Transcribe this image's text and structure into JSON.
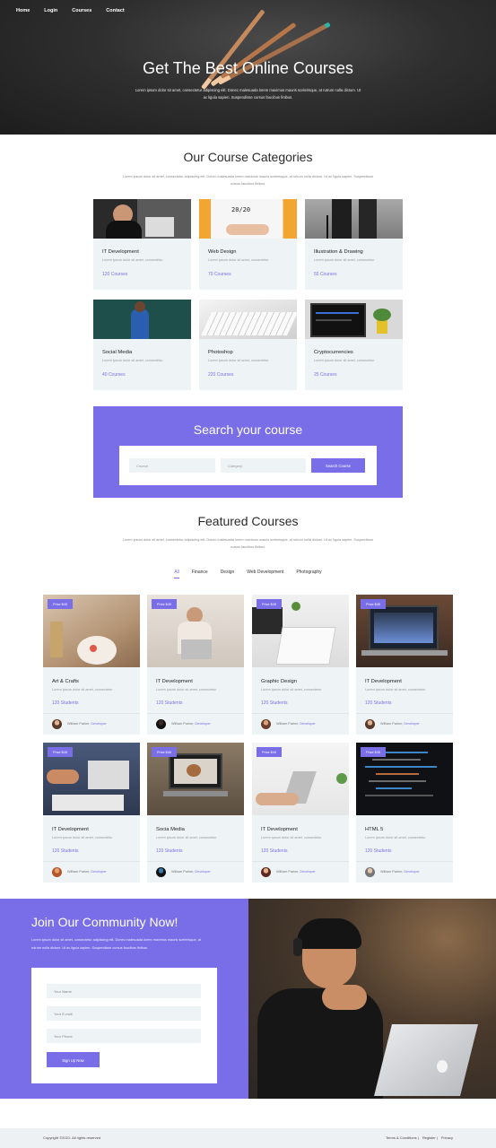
{
  "nav": [
    "Home",
    "Login",
    "Courses",
    "Contact"
  ],
  "hero": {
    "title": "Get The Best Online Courses",
    "subtitle": "Lorem ipsum dolor sit amet, consectetur adipiscing elit. Donec malesuada lorem maximus mauris scelerisque, at rutrum nulla dictum. Ut ac ligula sapien. Suspendisse cursus faucibus finibus."
  },
  "categories": {
    "title": "Our Course Categories",
    "text": "Lorem ipsum dolor sit amet, consectetur adipiscing elit. Donec malesuada lorem maximus mauris scelerisque, at rutrum nulla dictum. Ut ac ligula sapien. Suspendisse cursus faucibus finibus.",
    "items": [
      {
        "name": "IT Development",
        "desc": "Lorem ipsum dolor sit amet, consectetur",
        "count": "120 Courses"
      },
      {
        "name": "Web Design",
        "desc": "Lorem ipsum dolor sit amet, consectetur",
        "count": "70 Courses"
      },
      {
        "name": "Illustration & Drawing",
        "desc": "Lorem ipsum dolor sit amet, consectetur",
        "count": "55 Courses"
      },
      {
        "name": "Social Media",
        "desc": "Lorem ipsum dolor sit amet, consectetur",
        "count": "40 Courses"
      },
      {
        "name": "Photoshop",
        "desc": "Lorem ipsum dolor sit amet, consectetur",
        "count": "220 Courses"
      },
      {
        "name": "Cryptocurrencies",
        "desc": "Lorem ipsum dolor sit amet, consectetur",
        "count": "25 Courses"
      }
    ],
    "tshirt_text": "20/20"
  },
  "search": {
    "title": "Search your course",
    "course_placeholder": "Course",
    "category_placeholder": "Category",
    "button": "Search Course"
  },
  "featured": {
    "title": "Featured Courses",
    "text": "Lorem ipsum dolor sit amet, consectetur adipiscing elit. Donec malesuada lorem maximus mauris scelerisque, at rutrum nulla dictum. Ut ac ligula sapien. Suspendisse cursus faucibus finibus.",
    "tabs": [
      "All",
      "Finance",
      "Design",
      "Web Development",
      "Photography"
    ],
    "courses": [
      {
        "price": "Price $45",
        "name": "Art & Crafts",
        "desc": "Lorem ipsum dolor sit amet, consectetur",
        "students": "120 Students",
        "author": "William Parker,",
        "role": "Developer"
      },
      {
        "price": "Price $45",
        "name": "IT Development",
        "desc": "Lorem ipsum dolor sit amet, consectetur",
        "students": "120 Students",
        "author": "William Parker,",
        "role": "Developer"
      },
      {
        "price": "Price $45",
        "name": "Graphic Design",
        "desc": "Lorem ipsum dolor sit amet, consectetur",
        "students": "120 Students",
        "author": "William Parker,",
        "role": "Developer"
      },
      {
        "price": "Price $45",
        "name": "IT Development",
        "desc": "Lorem ipsum dolor sit amet, consectetur",
        "students": "120 Students",
        "author": "William Parker,",
        "role": "Developer"
      },
      {
        "price": "Price $45",
        "name": "IT Development",
        "desc": "Lorem ipsum dolor sit amet, consectetur",
        "students": "120 Students",
        "author": "William Parker,",
        "role": "Developer"
      },
      {
        "price": "Price $45",
        "name": "Socia Media",
        "desc": "Lorem ipsum dolor sit amet, consectetur",
        "students": "120 Students",
        "author": "William Parker,",
        "role": "Developer"
      },
      {
        "price": "Price $45",
        "name": "IT Development",
        "desc": "Lorem ipsum dolor sit amet, consectetur",
        "students": "120 Students",
        "author": "William Parker,",
        "role": "Developer"
      },
      {
        "price": "Price $45",
        "name": "HTML 5",
        "desc": "Lorem ipsum dolor sit amet, consectetur",
        "students": "120 Students",
        "author": "William Parker,",
        "role": "Developer"
      }
    ]
  },
  "join": {
    "title": "Join Our Community Now!",
    "text": "Lorem ipsum dolor sit amet, consectetur adipiscing elit. Donec malesuada lorem maximus mauris scelerisque, at rutrum nulla dictum. Ut ac ligula sapien. Suspendisse cursus faucibus finibus.",
    "name_placeholder": "Your Name",
    "email_placeholder": "Your E-mail",
    "phone_placeholder": "Your Phone",
    "button": "Sign Up Now"
  },
  "footer": {
    "copyright": "Copyright ©2021. All rights reserved",
    "links": [
      "Terms & Conditions |",
      "Register |",
      "Privacy"
    ]
  },
  "colors": {
    "accent": "#7a6ee8",
    "card_bg": "#eef3f5",
    "hero_bg": "#2f2f2f"
  }
}
